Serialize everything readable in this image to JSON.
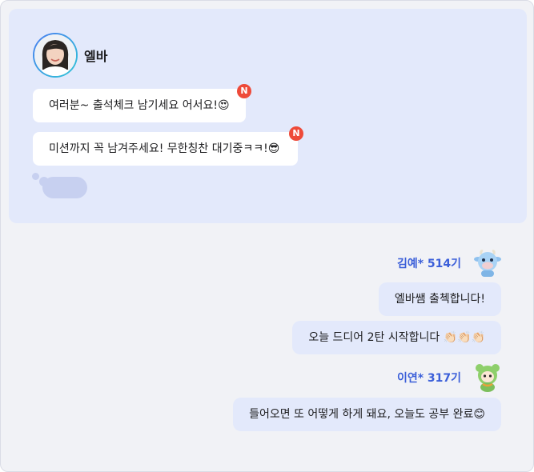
{
  "host": {
    "name": "엘바",
    "messages": [
      {
        "text": "여러분~ 출석체크 남기세요 어서요!😍",
        "badge": "N"
      },
      {
        "text": "미션까지 꼭 남겨주세요! 무한칭찬 대기중ㅋㅋ!😎",
        "badge": "N"
      }
    ]
  },
  "users": [
    {
      "label": "김예* 514기",
      "avatar_icon": "blue-cow-icon",
      "messages": [
        "엘바쌤 출첵합니다!",
        "오늘 드디어 2탄 시작합니다 👏🏻👏🏻👏🏻"
      ]
    },
    {
      "label": "이연* 317기",
      "avatar_icon": "green-bear-icon",
      "messages": [
        "들어오면 또 어떻게 하게 돼요, 오늘도 공부 완료😊"
      ]
    }
  ],
  "colors": {
    "host_panel": "#e3e9fb",
    "badge": "#ee4a39",
    "user_label": "#3b5fd9"
  }
}
